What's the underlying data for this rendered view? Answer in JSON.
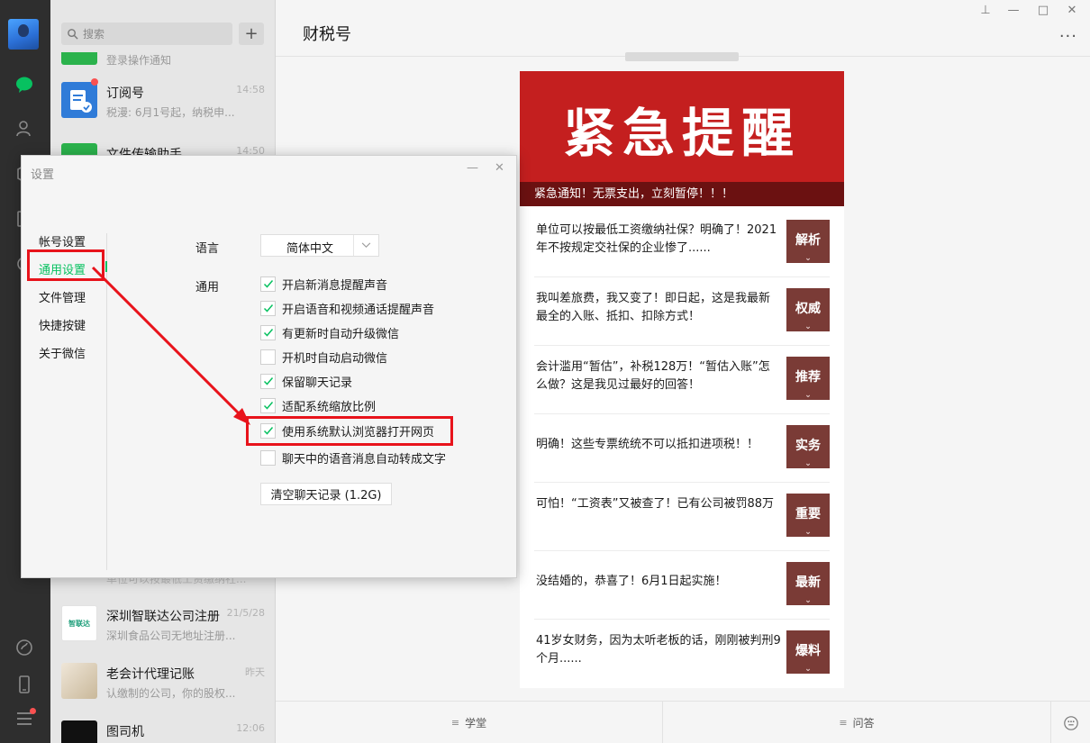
{
  "sidebar": {
    "icons": [
      "avatar",
      "chat-icon",
      "contacts-icon",
      "favorites-icon",
      "files-icon",
      "moments-icon",
      "miniprogram-icon",
      "phone-icon",
      "menu-icon"
    ]
  },
  "chat_list": {
    "search_placeholder": "搜索",
    "add_label": "+",
    "top_partial": "登录操作通知",
    "items": [
      {
        "name": "订阅号",
        "preview": "税漫: 6月1号起，纳税申...",
        "time": "14:58"
      },
      {
        "name": "文件传输助手",
        "preview": "",
        "time": "14:50"
      },
      {
        "name": "深圳智联达公司注册",
        "preview": "深圳食品公司无地址注册...",
        "time": "21/5/28",
        "avatar_text": "智联达"
      },
      {
        "name": "老会计代理记账",
        "preview": "认缴制的公司，你的股权...",
        "time": "昨天"
      },
      {
        "name": "图司机",
        "preview": "",
        "time": "12:06"
      }
    ],
    "partial_row": "单位可以按最低工资缴纳社..."
  },
  "chat": {
    "title": "财税号",
    "window_controls": {
      "pin": "⊥",
      "minimize": "—",
      "maximize": "□",
      "close": "✕"
    },
    "more": "···",
    "banner": {
      "headline": "紧急提醒",
      "caption": "紧急通知！无票支出，立刻暂停！！！"
    },
    "articles": [
      {
        "text": "单位可以按最低工资缴纳社保？明确了！2021年不按规定交社保的企业惨了......",
        "tag": "解析"
      },
      {
        "text": "我叫差旅费，我又变了！即日起，这是我最新最全的入账、抵扣、扣除方式！",
        "tag": "权威"
      },
      {
        "text": "会计滥用“暂估”，补税128万！“暂估入账”怎么做？这是我见过最好的回答！",
        "tag": "推荐"
      },
      {
        "text": "明确！这些专票统统不可以抵扣进项税！！",
        "tag": "实务"
      },
      {
        "text": "可怕！“工资表”又被查了！已有公司被罚88万",
        "tag": "重要"
      },
      {
        "text": "没结婚的，恭喜了！6月1日起实施！",
        "tag": "最新"
      },
      {
        "text": "41岁女财务，因为太听老板的话，刚刚被判刑9个月......",
        "tag": "爆料"
      }
    ],
    "footer": {
      "left": "学堂",
      "right": "问答"
    }
  },
  "settings": {
    "title": "设置",
    "minimize": "—",
    "close": "✕",
    "nav": [
      {
        "label": "帐号设置",
        "active": false
      },
      {
        "label": "通用设置",
        "active": true
      },
      {
        "label": "文件管理",
        "active": false
      },
      {
        "label": "快捷按键",
        "active": false
      },
      {
        "label": "关于微信",
        "active": false
      }
    ],
    "language_label": "语言",
    "language_value": "简体中文",
    "general_label": "通用",
    "options": [
      {
        "label": "开启新消息提醒声音",
        "checked": true
      },
      {
        "label": "开启语音和视频通话提醒声音",
        "checked": true
      },
      {
        "label": "有更新时自动升级微信",
        "checked": true
      },
      {
        "label": "开机时自动启动微信",
        "checked": false
      },
      {
        "label": "保留聊天记录",
        "checked": true
      },
      {
        "label": "适配系统缩放比例",
        "checked": true
      },
      {
        "label": "使用系统默认浏览器打开网页",
        "checked": true
      },
      {
        "label": "聊天中的语音消息自动转成文字",
        "checked": false
      }
    ],
    "clear_button": "清空聊天记录 (1.2G)"
  },
  "colors": {
    "accent_green": "#07c160",
    "highlight_red": "#e8131b",
    "banner_red": "#c41f1f",
    "tag_brown": "#7a3b36"
  }
}
